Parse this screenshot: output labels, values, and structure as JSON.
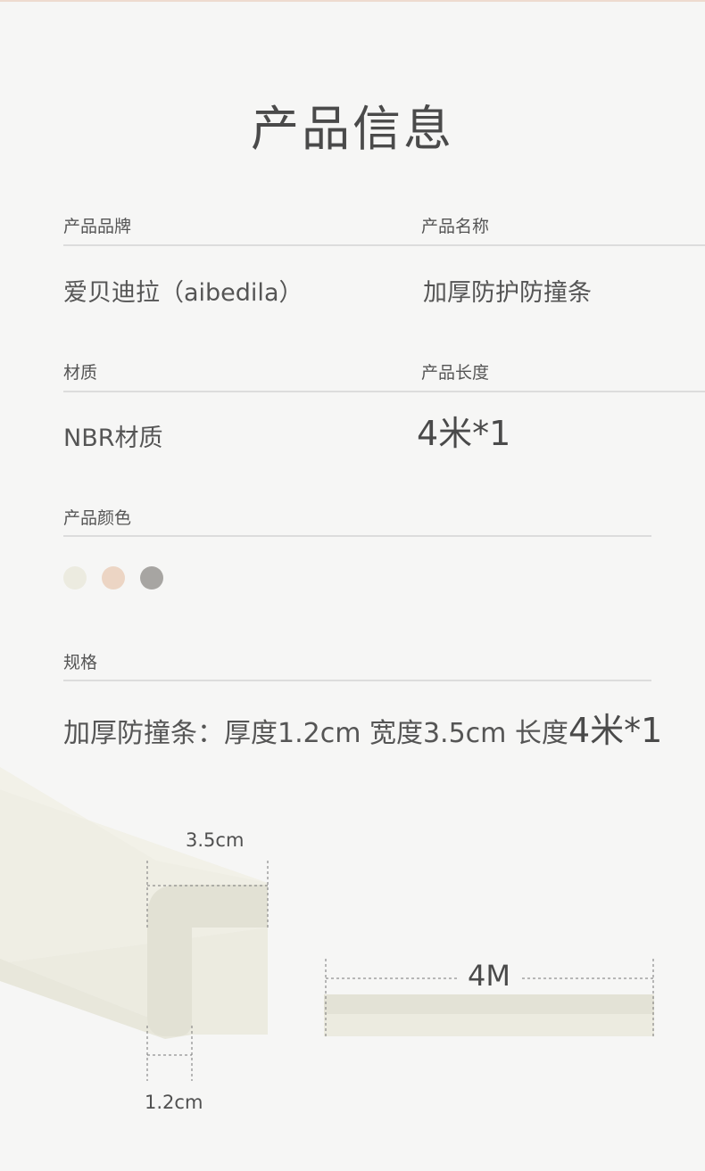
{
  "title": "产品信息",
  "brand": {
    "label": "产品品牌",
    "value": "爱贝迪拉（aibedila）"
  },
  "name": {
    "label": "产品名称",
    "value": "加厚防护防撞条"
  },
  "material": {
    "label": "材质",
    "value": "NBR材质"
  },
  "length": {
    "label": "产品长度",
    "value": "4米*1"
  },
  "color": {
    "label": "产品颜色",
    "swatches": [
      "#ecebe0",
      "#ecd5c4",
      "#a7a5a2"
    ]
  },
  "spec": {
    "label": "规格",
    "text": "加厚防撞条：厚度1.2cm  宽度3.5cm 长度",
    "length": "4米*1"
  },
  "diagram": {
    "width_label": "3.5cm",
    "thickness_label": "1.2cm",
    "length_label": "4M",
    "product_color": "#ecebe0",
    "product_color_light": "#f1f0e7",
    "product_color_shadow": "#e3e2d6"
  }
}
